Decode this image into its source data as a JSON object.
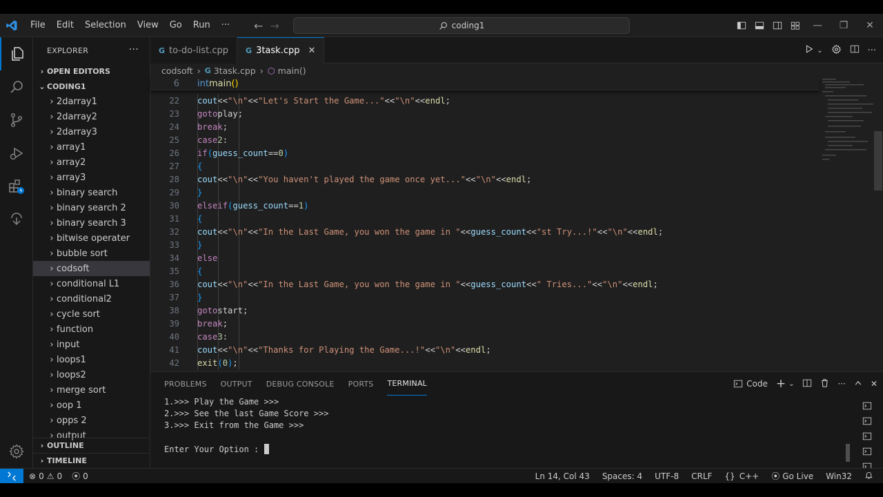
{
  "window": {
    "search_text": "coding1"
  },
  "menu": [
    "File",
    "Edit",
    "Selection",
    "View",
    "Go",
    "Run",
    "···"
  ],
  "explorer": {
    "title": "EXPLORER",
    "open_editors": "OPEN EDITORS",
    "root": "CODING1",
    "folders": [
      "2darray1",
      "2darray2",
      "2darray3",
      "array1",
      "array2",
      "array3",
      "binary search",
      "binary search 2",
      "binary search 3",
      "bitwise operater",
      "bubble sort",
      "codsoft",
      "conditional L1",
      "conditional2",
      "cycle sort",
      "function",
      "input",
      "loops1",
      "loops2",
      "merge sort",
      "oop 1",
      "opps 2",
      "output"
    ],
    "selected": "codsoft",
    "outline": "OUTLINE",
    "timeline": "TIMELINE"
  },
  "tabs": [
    {
      "label": "to-do-list.cpp",
      "active": false
    },
    {
      "label": "3task.cpp",
      "active": true
    }
  ],
  "breadcrumb": {
    "folder": "codsoft",
    "file": "3task.cpp",
    "symbol": "main()"
  },
  "code": {
    "sticky_num": "6",
    "lines": [
      {
        "n": "22"
      },
      {
        "n": "23"
      },
      {
        "n": "24"
      },
      {
        "n": "25"
      },
      {
        "n": "26"
      },
      {
        "n": "27"
      },
      {
        "n": "28"
      },
      {
        "n": "29"
      },
      {
        "n": "30"
      },
      {
        "n": "31"
      },
      {
        "n": "32"
      },
      {
        "n": "33"
      },
      {
        "n": "34"
      },
      {
        "n": "35"
      },
      {
        "n": "36"
      },
      {
        "n": "37"
      },
      {
        "n": "38"
      },
      {
        "n": "39"
      },
      {
        "n": "40"
      },
      {
        "n": "41"
      },
      {
        "n": "42"
      }
    ],
    "strings": {
      "start_game": "\"Let's Start the Game...\"",
      "not_played": "\"You haven't played the game once yet...\"",
      "won_in": "\"In the Last Game, you won the game in \"",
      "st_try": "\"st Try...!\"",
      "tries": "\" Tries...\"",
      "thanks": "\"Thanks for Playing the Game...!\"",
      "nl": "\"\\n\""
    }
  },
  "panel": {
    "tabs": [
      "PROBLEMS",
      "OUTPUT",
      "DEBUG CONSOLE",
      "PORTS",
      "TERMINAL"
    ],
    "active_tab": "TERMINAL",
    "shell_label": "Code",
    "terminal_lines": [
      "1.>>> Play the Game >>>",
      "2.>>> See the last Game Score >>>",
      "3.>>> Exit from the Game >>>",
      "",
      "Enter Your Option : "
    ]
  },
  "status": {
    "errors": "0",
    "warnings": "0",
    "ports": "0",
    "position": "Ln 14, Col 43",
    "spaces": "Spaces: 4",
    "encoding": "UTF-8",
    "eol": "CRLF",
    "language": "C++",
    "go_live": "Go Live",
    "platform": "Win32"
  },
  "colors": {
    "accent": "#0078d4",
    "keyword": "#c586c0",
    "type": "#569cd6",
    "function": "#dcdcaa",
    "string": "#ce9178",
    "variable": "#9cdcfe",
    "number": "#b5cea8"
  }
}
